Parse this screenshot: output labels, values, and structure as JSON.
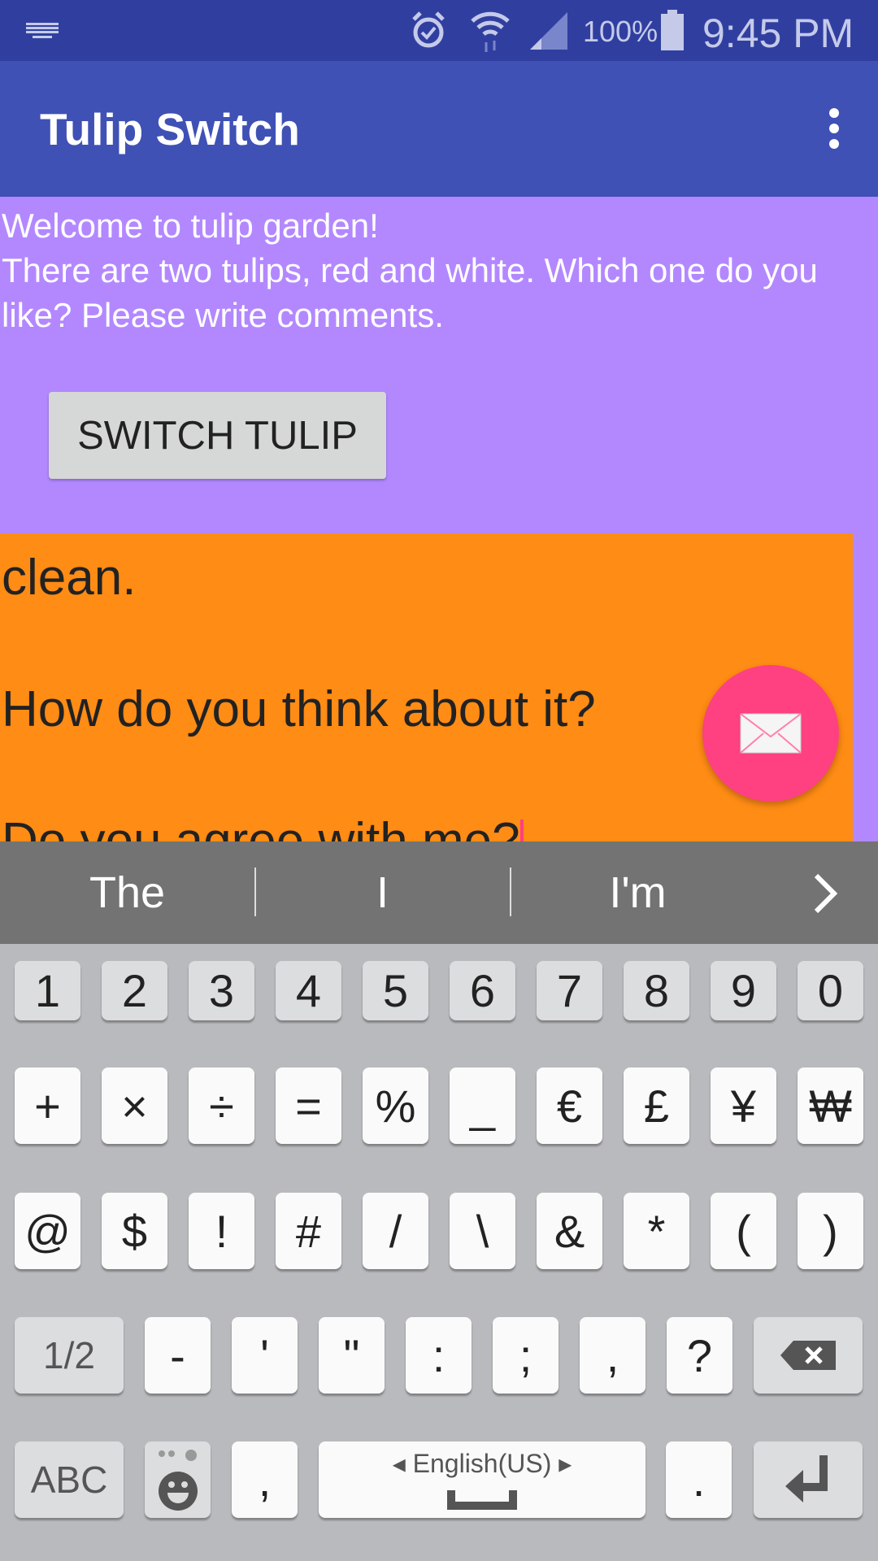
{
  "status_bar": {
    "battery": "100%",
    "time": "9:45 PM",
    "icons": [
      "keyboard-icon",
      "alarm-icon",
      "wifi-icon",
      "signal-icon",
      "battery-icon"
    ]
  },
  "app_bar": {
    "title": "Tulip Switch",
    "menu_icon": "overflow-menu-icon"
  },
  "main": {
    "welcome_line1": "Welcome to tulip garden!",
    "welcome_line2": "There are two tulips, red and white. Which one do you like? Please write comments.",
    "switch_button": "SWITCH TULIP",
    "comment_text": "clean.\n\nHow do you think about it?\n\nDo you agree with me?",
    "fab_icon": "mail-icon"
  },
  "colors": {
    "status": "#303F9F",
    "primary": "#3F51B5",
    "background": "#B388FF",
    "comment": "#FF8C14",
    "accent": "#FF4081"
  },
  "suggestions": [
    "The",
    "I",
    "I'm"
  ],
  "keyboard": {
    "row1": [
      "1",
      "2",
      "3",
      "4",
      "5",
      "6",
      "7",
      "8",
      "9",
      "0"
    ],
    "row2": [
      "+",
      "×",
      "÷",
      "=",
      "%",
      "_",
      "€",
      "£",
      "¥",
      "₩"
    ],
    "row3": [
      "@",
      "$",
      "!",
      "#",
      "/",
      "\\",
      "&",
      "*",
      "(",
      ")"
    ],
    "row4": [
      "1/2",
      "-",
      "'",
      "\"",
      ":",
      ";",
      ",",
      "?"
    ],
    "row5": {
      "abc": "ABC",
      "comma": ",",
      "space_language": "English(US)",
      "period": "."
    }
  }
}
